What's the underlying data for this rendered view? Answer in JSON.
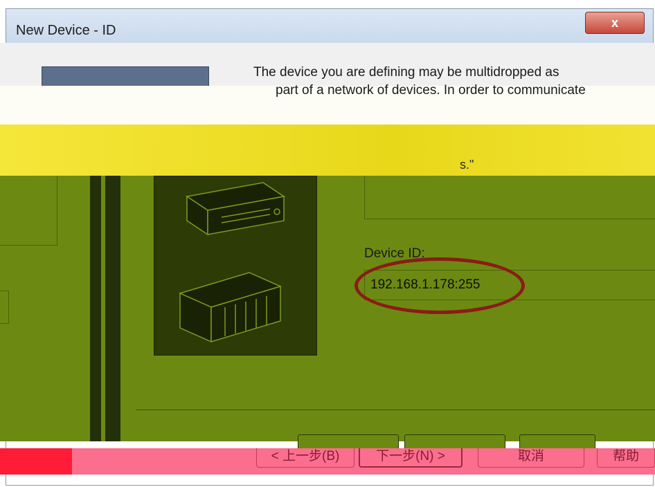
{
  "window": {
    "title": "New Device - ID",
    "close_glyph": "x"
  },
  "description": {
    "line1": "The device you are defining may be multidropped as",
    "line2": "part of a network of devices.  In order to communicate",
    "line3": "",
    "tail": "s.\""
  },
  "device_id": {
    "label": "Device ID:",
    "value": "192.168.1.178:255"
  },
  "buttons": {
    "back": "< 上一步(B)",
    "next": "下一步(N) >",
    "cancel": "取消",
    "help": "帮助"
  },
  "colors": {
    "highlight_circle": "#8b1b17",
    "body": "#6c8a12"
  },
  "icons": [
    "close-icon",
    "computer-icon",
    "plc-rack-icon"
  ]
}
